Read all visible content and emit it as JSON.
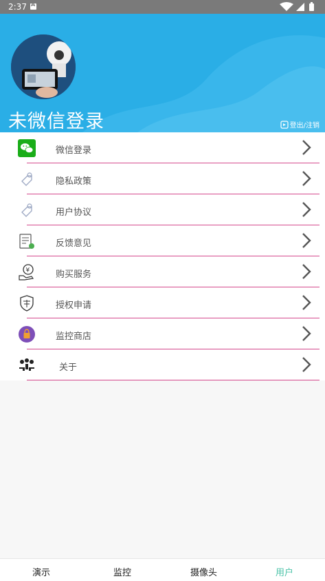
{
  "status_bar": {
    "time": "2:37",
    "notification_glyph": "A"
  },
  "header": {
    "username": "未微信登录",
    "logout_label": "登出/注销"
  },
  "menu": {
    "items": [
      {
        "label": "微信登录",
        "icon": "wechat-icon"
      },
      {
        "label": "隐私政策",
        "icon": "tag-icon"
      },
      {
        "label": "用户协议",
        "icon": "tag-icon"
      },
      {
        "label": "反馈意见",
        "icon": "feedback-icon"
      },
      {
        "label": "购买服务",
        "icon": "purchase-icon"
      },
      {
        "label": "授权申请",
        "icon": "authorize-shield-icon"
      },
      {
        "label": "监控商店",
        "icon": "shop-icon"
      },
      {
        "label": "关于",
        "icon": "people-icon"
      }
    ]
  },
  "bottom_nav": {
    "tabs": [
      {
        "label": "演示"
      },
      {
        "label": "监控"
      },
      {
        "label": "摄像头"
      },
      {
        "label": "用户"
      }
    ],
    "active_tab": "用户"
  },
  "colors": {
    "header_blue": "#2aaee6",
    "divider_pink": "#d4468b",
    "active_tab_green": "#4cc3a8",
    "wechat_green": "#1aad19"
  }
}
